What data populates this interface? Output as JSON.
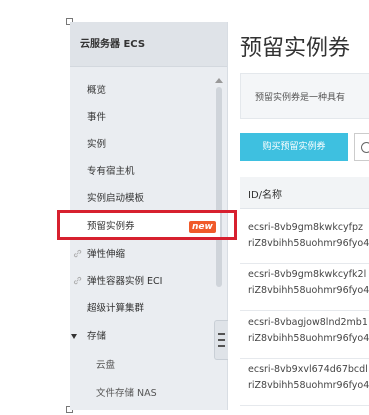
{
  "sidebar": {
    "title": "云服务器 ECS",
    "items": [
      {
        "label": "概览"
      },
      {
        "label": "事件"
      },
      {
        "label": "实例"
      },
      {
        "label": "专有宿主机"
      },
      {
        "label": "实例启动模板"
      },
      {
        "label": "预留实例券",
        "badge": "new"
      },
      {
        "label": "弹性伸缩"
      },
      {
        "label": "弹性容器实例 ECI"
      },
      {
        "label": "超级计算集群"
      },
      {
        "label": "存储"
      },
      {
        "label": "云盘"
      },
      {
        "label": "文件存储 NAS"
      }
    ]
  },
  "main": {
    "title": "预留实例券",
    "description": "预留实例券是一种具有",
    "buy_button": "购买预留实例券",
    "table": {
      "header": "ID/名称",
      "rows": [
        {
          "id": "ecsri-8vb9gm8kwkcyfpz",
          "name": "riZ8vbihh58uohmr96fyo4"
        },
        {
          "id": "ecsri-8vb9gm8kwkcyfk2l",
          "name": "riZ8vbihh58uohmr96fyo4"
        },
        {
          "id": "ecsri-8vbagjow8lnd2mb1",
          "name": "riZ8vbihh58uohmr96fyo4"
        },
        {
          "id": "ecsri-8vb9xvl674d67bcdl",
          "name": "riZ8vbihh58uohmr96fyo4"
        }
      ]
    }
  },
  "colors": {
    "accent": "#3ec0e0",
    "highlight": "#d7202f",
    "badge": "#f05a2a",
    "sidebar_bg": "#eaedf1"
  }
}
